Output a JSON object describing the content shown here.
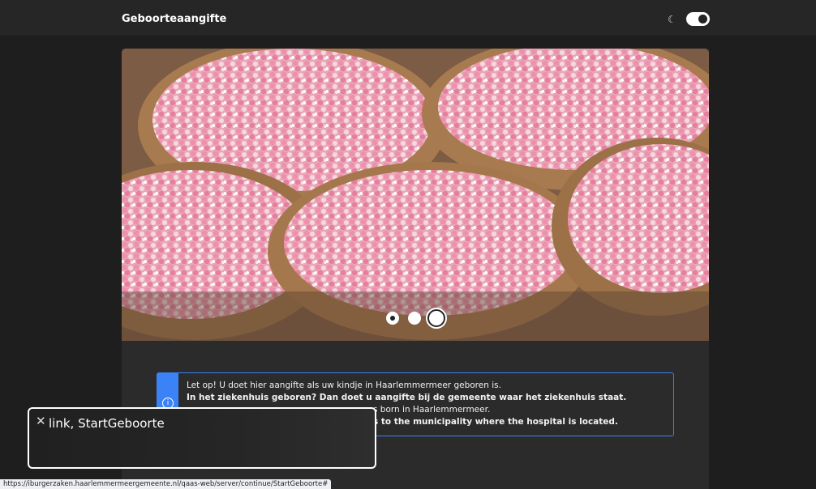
{
  "header": {
    "title": "Geboorteaangifte",
    "theme_icon": "moon-icon",
    "theme_toggle_state": "on"
  },
  "carousel": {
    "slide_count": 3,
    "active_index": 2,
    "image_subject": "beschuit met muisjes"
  },
  "notice": {
    "icon": "info-icon",
    "line1": "Let op! U doet hier aangifte als uw kindje in Haarlemmermeer geboren is.",
    "line2": "In het ziekenhuis geboren? Dan doet u aangifte bij de gemeente waar het ziekenhuis staat.",
    "line3": "s born in Haarlemmermeer.",
    "line4": "s to the municipality where the hospital is located."
  },
  "tooltip": {
    "close_icon": "close-icon",
    "label": "link, StartGeboorte"
  },
  "statusbar": {
    "url": "https://iburgerzaken.haarlemmermeergemeente.nl/qaas-web/server/continue/StartGeboorte#"
  },
  "colors": {
    "accent": "#3b82f6",
    "background": "#1e1e1e"
  }
}
